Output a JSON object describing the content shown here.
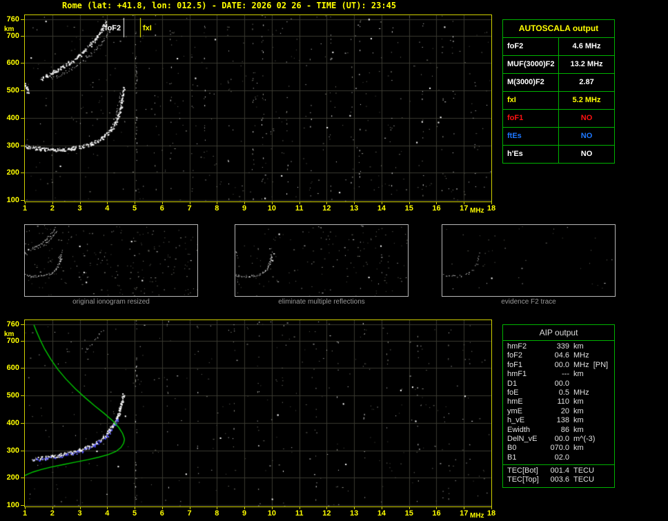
{
  "title": "Rome (lat: +41.8, lon: 012.5) - DATE: 2026 02 26 - TIME (UT): 23:45",
  "colors": {
    "background": "#000000",
    "axis_text": "#ffff00",
    "plot_border": "#d2d200",
    "grid": "#3a3a31",
    "table_border": "#00b400",
    "trace_white": "#ffffff",
    "profile_green": "#00cc00",
    "restored_blue": "#4343ff",
    "caption_gray": "#9a9a9a",
    "no_red": "#ff1212",
    "no_blue": "#1e78ff"
  },
  "autoscala_table": {
    "header": "AUTOSCALA output",
    "rows": [
      {
        "label": "foF2",
        "value": "4.6 MHz",
        "color": "#ffffff"
      },
      {
        "label": "MUF(3000)F2",
        "value": "13.2 MHz",
        "color": "#ffffff"
      },
      {
        "label": "M(3000)F2",
        "value": "2.87",
        "color": "#ffffff"
      },
      {
        "label": "fxI",
        "value": "5.2 MHz",
        "color": "#ffff00"
      },
      {
        "label": "foF1",
        "value": "NO",
        "color": "#ff1212"
      },
      {
        "label": "ftEs",
        "value": "NO",
        "color": "#1e78ff"
      },
      {
        "label": "h'Es",
        "value": "NO",
        "color": "#ffffff"
      }
    ]
  },
  "aip_table": {
    "header": "AIP output",
    "rows": [
      {
        "name": "hmF2",
        "value": "339",
        "unit": "km"
      },
      {
        "name": "foF2",
        "value": "04.6",
        "unit": "MHz"
      },
      {
        "name": "foF1",
        "value": "00.0",
        "unit": "MHz  [PN]"
      },
      {
        "name": "hmF1",
        "value": "---",
        "unit": "km"
      },
      {
        "name": "D1",
        "value": "00.0",
        "unit": ""
      },
      {
        "name": "foE",
        "value": "0.5",
        "unit": "MHz"
      },
      {
        "name": "hmE",
        "value": "110",
        "unit": "km"
      },
      {
        "name": "ymE",
        "value": "20",
        "unit": "km"
      },
      {
        "name": "h_vE",
        "value": "138",
        "unit": "km"
      },
      {
        "name": "Ewidth",
        "value": "86",
        "unit": "km"
      },
      {
        "name": "DelN_vE",
        "value": "00.0",
        "unit": "m^(-3)"
      },
      {
        "name": "B0",
        "value": "070.0",
        "unit": "km"
      },
      {
        "name": "B1",
        "value": "02.0",
        "unit": ""
      }
    ],
    "tec_rows": [
      {
        "name": "TEC[Bot]",
        "value": "001.4",
        "unit": "TECU"
      },
      {
        "name": "TEC[Top]",
        "value": "003.6",
        "unit": "TECU"
      }
    ]
  },
  "panels": [
    {
      "caption": "original ionogram resized"
    },
    {
      "caption": "eliminate multiple reflections"
    },
    {
      "caption": "evidence F2 trace"
    }
  ],
  "thumbnails": [
    {
      "traces": {
        "f2_ordinary": 1.3,
        "f2_second_hop": 1.0,
        "f2_second_hop_branch": 0.6,
        "f2_inner_branch": 0.5,
        "left_cluster": 1.6
      },
      "speckles": 230,
      "seed": 5
    },
    {
      "traces": {
        "f2_ordinary": 1.3,
        "f2_inner_branch": 0.5,
        "left_cluster": 1.0
      },
      "speckles": 160,
      "seed": 9
    },
    {
      "traces": {
        "f2_ordinary": 0.55
      },
      "speckles": 40,
      "seed": 13
    }
  ],
  "chart_data": [
    {
      "id": "top_ionogram",
      "type": "scatter",
      "title": "raw ionogram with autoscaled characteristics",
      "xlabel": "MHz",
      "ylabel": "km",
      "xlim": [
        1,
        18
      ],
      "ylim": [
        100,
        760
      ],
      "grid": true,
      "x_ticks": [
        1,
        2,
        3,
        4,
        5,
        6,
        7,
        8,
        9,
        10,
        11,
        12,
        13,
        14,
        15,
        16,
        17,
        18
      ],
      "y_ticks": [
        760,
        700,
        600,
        500,
        400,
        300,
        200,
        100
      ],
      "markers": [
        {
          "label": "foF2",
          "freq": 4.6,
          "color": "#ffffff"
        },
        {
          "label": "fxI",
          "freq": 5.2,
          "color": "#ffff00"
        }
      ],
      "traces": {
        "f2_ordinary": [
          [
            1.0,
            298
          ],
          [
            1.3,
            292
          ],
          [
            1.6,
            288
          ],
          [
            2.0,
            286
          ],
          [
            2.4,
            287
          ],
          [
            2.8,
            291
          ],
          [
            3.1,
            297
          ],
          [
            3.4,
            306
          ],
          [
            3.65,
            318
          ],
          [
            3.9,
            335
          ],
          [
            4.1,
            356
          ],
          [
            4.28,
            382
          ],
          [
            4.4,
            410
          ],
          [
            4.49,
            442
          ],
          [
            4.55,
            475
          ],
          [
            4.6,
            512
          ]
        ],
        "f2_inner_branch": [
          [
            4.12,
            362
          ],
          [
            4.25,
            392
          ],
          [
            4.35,
            424
          ],
          [
            4.42,
            458
          ],
          [
            4.47,
            492
          ]
        ],
        "f2_second_hop": [
          [
            1.55,
            542
          ],
          [
            1.8,
            556
          ],
          [
            2.05,
            570
          ],
          [
            2.35,
            586
          ],
          [
            2.65,
            604
          ],
          [
            2.95,
            626
          ],
          [
            3.2,
            650
          ],
          [
            3.45,
            676
          ],
          [
            3.65,
            702
          ],
          [
            3.82,
            728
          ],
          [
            3.95,
            752
          ]
        ],
        "f2_second_hop_branch": [
          [
            1.9,
            540
          ],
          [
            2.15,
            552
          ],
          [
            2.45,
            566
          ],
          [
            2.75,
            583
          ],
          [
            3.05,
            603
          ],
          [
            3.35,
            627
          ],
          [
            3.6,
            653
          ],
          [
            3.85,
            682
          ],
          [
            4.05,
            712
          ],
          [
            4.18,
            740
          ]
        ],
        "left_cluster": [
          [
            1.0,
            525
          ],
          [
            1.05,
            510
          ],
          [
            1.12,
            494
          ]
        ]
      },
      "noise": {
        "seed": 11,
        "speckles": 420,
        "columns": [
          [
            5.05,
            36
          ],
          [
            5.75,
            8
          ],
          [
            6.3,
            12
          ],
          [
            7.1,
            9
          ],
          [
            7.55,
            14
          ],
          [
            8.4,
            10
          ],
          [
            9.3,
            16
          ],
          [
            9.65,
            20
          ],
          [
            10.55,
            12
          ],
          [
            11.4,
            9
          ],
          [
            12.15,
            13
          ],
          [
            12.9,
            8
          ],
          [
            13.2,
            14
          ],
          [
            14.35,
            10
          ],
          [
            15.5,
            12
          ],
          [
            16.2,
            8
          ],
          [
            16.6,
            10
          ],
          [
            17.4,
            7
          ]
        ]
      }
    },
    {
      "id": "bottom_ionogram",
      "type": "scatter",
      "title": "restored F2 trace with electron density profile",
      "xlabel": "MHz",
      "ylabel": "km",
      "xlim": [
        1,
        18
      ],
      "ylim": [
        100,
        760
      ],
      "grid": true,
      "x_ticks": [
        1,
        2,
        3,
        4,
        5,
        6,
        7,
        8,
        9,
        10,
        11,
        12,
        13,
        14,
        15,
        16,
        17,
        18
      ],
      "y_ticks": [
        760,
        700,
        600,
        500,
        400,
        300,
        200,
        100
      ],
      "traces": {
        "f2_trace": [
          [
            1.25,
            270
          ],
          [
            1.6,
            273
          ],
          [
            1.95,
            278
          ],
          [
            2.3,
            284
          ],
          [
            2.65,
            292
          ],
          [
            3.0,
            302
          ],
          [
            3.3,
            314
          ],
          [
            3.6,
            330
          ],
          [
            3.85,
            349
          ],
          [
            4.05,
            370
          ],
          [
            4.22,
            394
          ],
          [
            4.35,
            420
          ],
          [
            4.45,
            448
          ],
          [
            4.53,
            478
          ],
          [
            4.58,
            502
          ]
        ],
        "f2_second_hop_residual": [
          [
            3.2,
            665
          ],
          [
            3.45,
            690
          ],
          [
            3.65,
            715
          ],
          [
            3.85,
            742
          ]
        ]
      },
      "restored_trace": [
        [
          1.3,
          266
        ],
        [
          1.7,
          271
        ],
        [
          2.1,
          277
        ],
        [
          2.5,
          284
        ],
        [
          2.9,
          294
        ],
        [
          3.2,
          305
        ],
        [
          3.5,
          319
        ],
        [
          3.8,
          337
        ],
        [
          4.0,
          356
        ],
        [
          4.15,
          376
        ],
        [
          4.28,
          398
        ],
        [
          4.38,
          418
        ]
      ],
      "profile": [
        [
          1.33,
          758
        ],
        [
          1.42,
          735
        ],
        [
          1.55,
          705
        ],
        [
          1.72,
          670
        ],
        [
          1.95,
          632
        ],
        [
          2.2,
          596
        ],
        [
          2.5,
          560
        ],
        [
          2.85,
          524
        ],
        [
          3.2,
          492
        ],
        [
          3.55,
          462
        ],
        [
          3.9,
          434
        ],
        [
          4.2,
          408
        ],
        [
          4.42,
          384
        ],
        [
          4.56,
          362
        ],
        [
          4.62,
          345
        ],
        [
          4.63,
          339
        ],
        [
          4.6,
          326
        ],
        [
          4.5,
          310
        ],
        [
          4.32,
          296
        ],
        [
          4.05,
          285
        ],
        [
          3.7,
          275
        ],
        [
          3.3,
          266
        ],
        [
          2.85,
          257
        ],
        [
          2.4,
          248
        ],
        [
          1.95,
          239
        ],
        [
          1.6,
          230
        ],
        [
          1.3,
          221
        ],
        [
          1.08,
          212
        ],
        [
          1.0,
          208
        ]
      ],
      "profile_peak": {
        "hmF2_km": 339,
        "foF2_MHz": 4.6
      },
      "noise": {
        "seed": 23,
        "speckles": 300,
        "columns": [
          [
            5.05,
            30
          ],
          [
            6.2,
            10
          ],
          [
            7.3,
            8
          ],
          [
            8.6,
            9
          ],
          [
            9.5,
            14
          ],
          [
            10.4,
            8
          ],
          [
            11.6,
            10
          ],
          [
            12.4,
            9
          ],
          [
            13.35,
            12
          ],
          [
            14.2,
            8
          ],
          [
            15.3,
            10
          ],
          [
            16.45,
            8
          ],
          [
            17.2,
            6
          ]
        ]
      }
    }
  ]
}
